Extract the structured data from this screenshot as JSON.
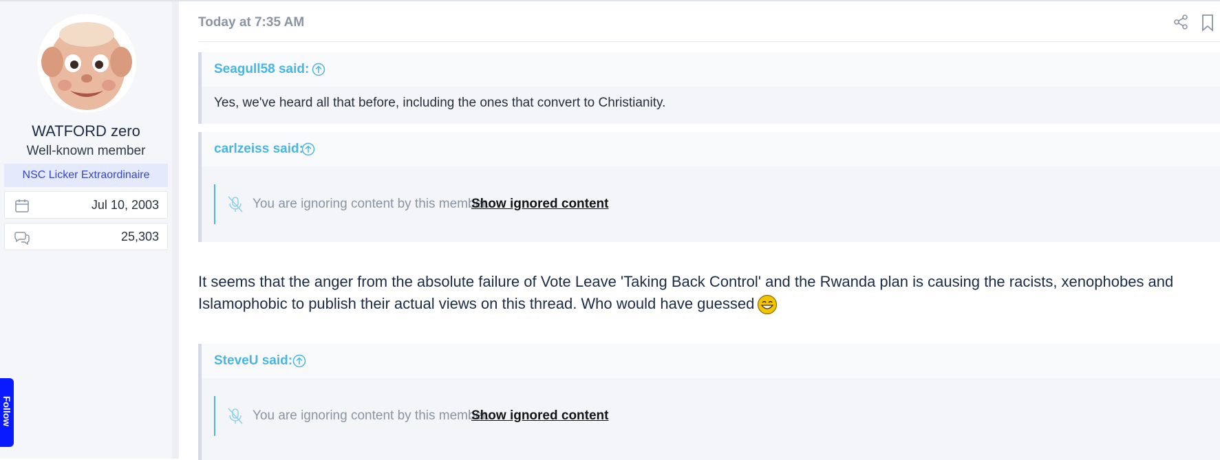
{
  "user": {
    "name": "WATFORD zero",
    "title": "Well-known member",
    "banner": "NSC Licker Extraordinaire",
    "joined": "Jul 10, 2003",
    "messages": "25,303",
    "joined_icon": "calendar-icon",
    "messages_icon": "chat-bubbles-icon"
  },
  "sidetab": {
    "label": "Follow"
  },
  "post": {
    "timestamp": "Today at 7:35 AM",
    "actions": [
      "share-icon",
      "bookmark-icon"
    ],
    "quotes": [
      {
        "author": "Seagull58 said:",
        "text": "Yes, we've heard all that before, including the ones that convert to Christianity."
      },
      {
        "author": "carlzeiss said:",
        "ignored_text": "You are ignoring content by this member.",
        "ignored_link": "Show ignored content"
      },
      {
        "author": "SteveU said:",
        "ignored_text": "You are ignoring content by this member.",
        "ignored_link": "Show ignored content"
      }
    ],
    "body": "It seems that the anger from the absolute failure of Vote Leave 'Taking Back Control' and the Rwanda plan is causing the racists, xenophobes and Islamophobic to publish their actual views on this thread. Who would have guessed"
  },
  "colors": {
    "quote_author": "#4ab5e0",
    "banner_bg": "#e4e9fb",
    "banner_text": "#3347c7",
    "sidetab": "#0a1aff"
  }
}
